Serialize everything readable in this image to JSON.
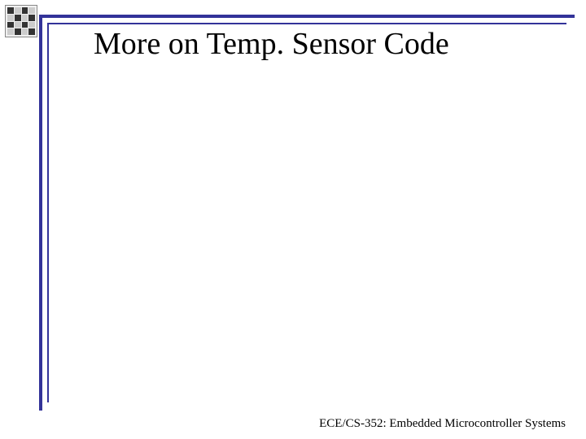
{
  "slide": {
    "title": "More on Temp. Sensor Code",
    "footer": "ECE/CS-352: Embedded Microcontroller Systems"
  }
}
